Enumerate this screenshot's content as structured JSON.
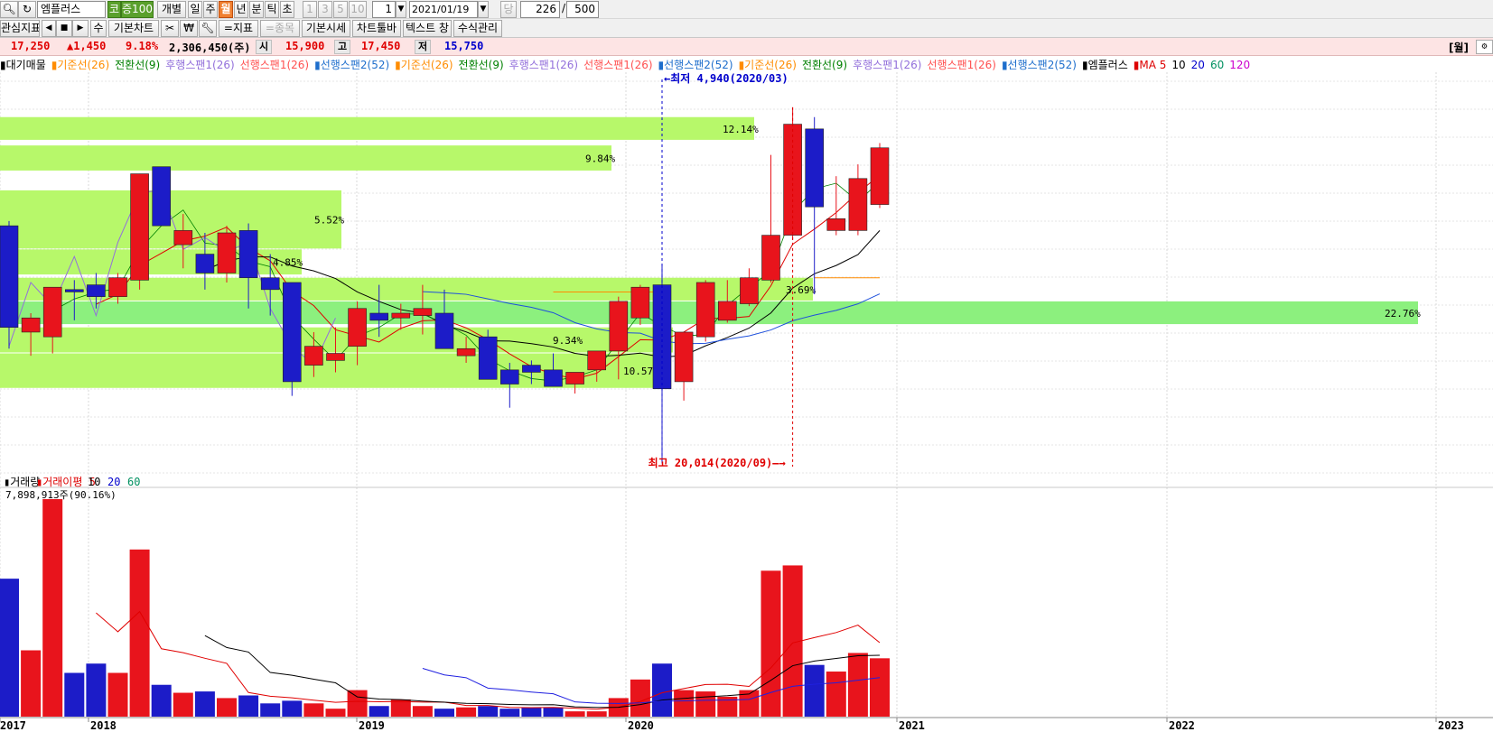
{
  "toolbar": {
    "search_icon": "magnifier",
    "refresh_icon": "refresh",
    "stock_name": "엠플러스",
    "kosdaq_badge": "코",
    "index_badge": "증100",
    "mode_individual": "개별",
    "period_tabs": [
      "일",
      "주",
      "월",
      "년",
      "분",
      "틱",
      "초"
    ],
    "active_period": "월",
    "interval_buttons": [
      "1",
      "3",
      "5",
      "10"
    ],
    "interval_value": "1",
    "date_value": "2021/01/19",
    "dang_label": "당",
    "count_value": "226",
    "count_sep": "/",
    "total_value": "500",
    "row2_buttons": [
      "관심지표",
      "수",
      "기본차트",
      "\\\\",
      "=지표",
      "=종목",
      "기본시세",
      "차트툴바",
      "텍스트 창",
      "수식관리"
    ]
  },
  "price_bar": {
    "current": "17,250",
    "change": "▲1,450",
    "change_pct": "9.18%",
    "volume": "2,306,450(주)",
    "open_label": "시",
    "open": "15,900",
    "high_label": "고",
    "high": "17,450",
    "low_label": "저",
    "low": "15,750",
    "period_btn": "[월]"
  },
  "legend": {
    "items": [
      {
        "text": "▮대기매물",
        "color": "#000000"
      },
      {
        "text": "▮기준선(26)",
        "color": "#ff8c00"
      },
      {
        "text": "전환선(9)",
        "color": "#008000"
      },
      {
        "text": "후행스팬1(26)",
        "color": "#9370db"
      },
      {
        "text": "선행스팬1(26)",
        "color": "#ff5050"
      },
      {
        "text": "▮선행스팬2(52)",
        "color": "#1e6ecc"
      },
      {
        "text": "▮기준선(26)",
        "color": "#ff8c00"
      },
      {
        "text": "전환선(9)",
        "color": "#008000"
      },
      {
        "text": "후행스팬1(26)",
        "color": "#9370db"
      },
      {
        "text": "선행스팬1(26)",
        "color": "#ff5050"
      },
      {
        "text": "▮선행스팬2(52)",
        "color": "#1e6ecc"
      },
      {
        "text": "▮기준선(26)",
        "color": "#ff8c00"
      },
      {
        "text": "전환선(9)",
        "color": "#008000"
      },
      {
        "text": "후행스팬1(26)",
        "color": "#9370db"
      },
      {
        "text": "선행스팬1(26)",
        "color": "#ff5050"
      },
      {
        "text": "▮선행스팬2(52)",
        "color": "#1e6ecc"
      },
      {
        "text": "▮엠플러스",
        "color": "#000000"
      },
      {
        "text": "▮MA 5",
        "color": "#dd0000"
      },
      {
        "text": "10",
        "color": "#000000"
      },
      {
        "text": "20",
        "color": "#0000cc"
      },
      {
        "text": "60",
        "color": "#009060"
      },
      {
        "text": "120",
        "color": "#cc00cc"
      }
    ]
  },
  "volume_legend": {
    "items": [
      {
        "text": "▮거래량",
        "color": "#000000"
      },
      {
        "text": "▮거래이평 5",
        "color": "#dd0000"
      },
      {
        "text": "10",
        "color": "#000000"
      },
      {
        "text": "20",
        "color": "#0000cc"
      },
      {
        "text": "60",
        "color": "#009060"
      }
    ],
    "last_value": "7,898,913주(90.16%)"
  },
  "annotations": {
    "low": "←최저 4,940(2020/03)",
    "high": "최고 20,014(2020/09)—→"
  },
  "x_axis_labels": [
    "2017",
    "2018",
    "2019",
    "2020",
    "2021",
    "2022",
    "2023"
  ],
  "colors": {
    "up": "#e8141c",
    "down": "#1c1cc8",
    "band": "#b7f86a",
    "band_strong": "#8cf07e"
  },
  "chart_data": {
    "type": "candlestick",
    "title": "",
    "x_label_positions_note": "",
    "months": [
      "2017/09",
      "2017/10",
      "2017/11",
      "2017/12",
      "2018/01",
      "2018/02",
      "2018/03",
      "2018/04",
      "2018/05",
      "2018/06",
      "2018/07",
      "2018/08",
      "2018/09",
      "2018/10",
      "2018/11",
      "2018/12",
      "2019/01",
      "2019/02",
      "2019/03",
      "2019/04",
      "2019/05",
      "2019/06",
      "2019/07",
      "2019/08",
      "2019/09",
      "2019/10",
      "2019/11",
      "2019/12",
      "2020/01",
      "2020/02",
      "2020/03",
      "2020/04",
      "2020/05",
      "2020/06",
      "2020/07",
      "2020/08",
      "2020/09",
      "2020/10",
      "2020/11",
      "2020/12",
      "2021/01"
    ],
    "ohlc": [
      [
        15000,
        15200,
        9800,
        10700
      ],
      [
        10500,
        11300,
        9500,
        11100
      ],
      [
        10300,
        12000,
        9600,
        12400
      ],
      [
        12300,
        12700,
        11000,
        12200
      ],
      [
        12500,
        13000,
        11500,
        12000
      ],
      [
        12000,
        13000,
        11700,
        12800
      ],
      [
        12700,
        17200,
        12300,
        17200
      ],
      [
        17500,
        17500,
        15000,
        15000
      ],
      [
        14200,
        15500,
        13200,
        14800
      ],
      [
        13800,
        14700,
        12300,
        13000
      ],
      [
        13000,
        15000,
        12600,
        14700
      ],
      [
        14800,
        15100,
        11500,
        12800
      ],
      [
        12800,
        13800,
        11200,
        12300
      ],
      [
        12600,
        12600,
        7800,
        8400
      ],
      [
        9100,
        10500,
        8600,
        9900
      ],
      [
        9300,
        10700,
        8800,
        9600
      ],
      [
        9900,
        11800,
        9100,
        11500
      ],
      [
        11300,
        12500,
        10300,
        11000
      ],
      [
        11100,
        11700,
        10600,
        11300
      ],
      [
        11200,
        12500,
        10400,
        11500
      ],
      [
        11300,
        12300,
        10100,
        9800
      ],
      [
        9500,
        10300,
        9200,
        9800
      ],
      [
        10300,
        10600,
        8900,
        8500
      ],
      [
        8900,
        9200,
        7300,
        8300
      ],
      [
        9100,
        9300,
        8300,
        8800
      ],
      [
        8900,
        9600,
        8600,
        8200
      ],
      [
        8300,
        8700,
        7900,
        8800
      ],
      [
        8900,
        9600,
        8400,
        9700
      ],
      [
        9700,
        12000,
        8500,
        11800
      ],
      [
        11100,
        12500,
        10800,
        12400
      ],
      [
        12500,
        13400,
        4940,
        8100
      ],
      [
        8400,
        8600,
        7600,
        10500
      ],
      [
        10300,
        12700,
        10100,
        12600
      ],
      [
        11000,
        12700,
        10900,
        11800
      ],
      [
        11700,
        13200,
        11600,
        12800
      ],
      [
        12700,
        18000,
        12600,
        14600
      ],
      [
        14600,
        20014,
        14400,
        19300
      ],
      [
        19100,
        19600,
        12100,
        15800
      ],
      [
        14800,
        17100,
        14600,
        15300
      ],
      [
        14800,
        17600,
        14600,
        17000
      ],
      [
        15900,
        18500,
        15750,
        18300
      ]
    ],
    "volume": [
      5200000,
      2500000,
      8200000,
      1650000,
      2000000,
      1650000,
      6300000,
      1200000,
      900000,
      950000,
      700000,
      800000,
      500000,
      600000,
      500000,
      300000,
      1000000,
      400000,
      650000,
      400000,
      300000,
      350000,
      400000,
      300000,
      350000,
      350000,
      200000,
      200000,
      700000,
      1400000,
      2000000,
      1000000,
      950000,
      750000,
      1000000,
      5500000,
      5700000,
      1950000,
      1700000,
      2400000,
      2200000
    ],
    "support_bands": [
      {
        "pct": "12.14%",
        "from": 1,
        "to": 13000
      },
      {
        "pct": "9.84%",
        "from": 1,
        "to": 11800
      },
      {
        "pct": "5.52%",
        "from": 1,
        "to": 4200
      },
      {
        "pct": "4.85%",
        "from": 1,
        "to": 3600
      },
      {
        "pct": "3.69%",
        "from": 1,
        "to": 11200
      },
      {
        "pct": "22.76%",
        "from": 1,
        "to": 24400
      },
      {
        "pct": "9.34%",
        "from": 1,
        "to": 7000
      },
      {
        "pct": "10.57%",
        "from": 1,
        "to": 7100
      }
    ],
    "y_range": [
      4500,
      21500
    ]
  }
}
